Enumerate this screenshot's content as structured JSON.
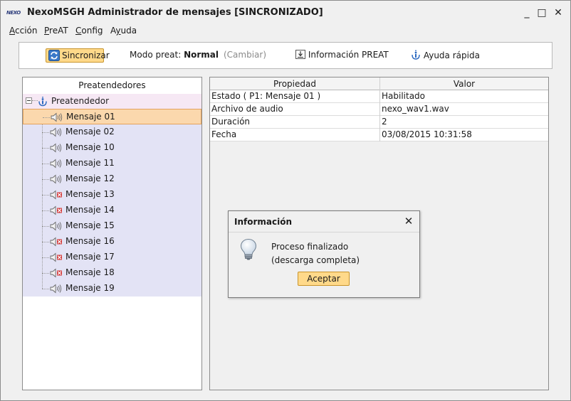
{
  "window": {
    "logo_text": "NEXO",
    "title": "NexoMSGH Administrador de mensajes [SINCRONIZADO]",
    "minimize": "_",
    "maximize": "□",
    "close": "✕"
  },
  "menu": [
    {
      "underline": "A",
      "rest": "cción"
    },
    {
      "underline": "P",
      "rest": "reAT"
    },
    {
      "underline": "C",
      "rest": "onfig"
    },
    {
      "pre": "A",
      "underline": "y",
      "rest": "uda"
    }
  ],
  "toolbar": {
    "sync_label": "Sincronizar",
    "mode_prefix": "Modo preat:",
    "mode_value": "Normal",
    "change_label": "(Cambiar)",
    "info_label": "Información PREAT",
    "help_label": "Ayuda rápida"
  },
  "tree": {
    "header": "Preatendedores",
    "root_label": "Preatendedor",
    "items": [
      {
        "label": "Mensaje 01",
        "status": "enabled",
        "selected": true
      },
      {
        "label": "Mensaje 02",
        "status": "enabled"
      },
      {
        "label": "Mensaje 10",
        "status": "enabled"
      },
      {
        "label": "Mensaje 11",
        "status": "enabled"
      },
      {
        "label": "Mensaje 12",
        "status": "enabled"
      },
      {
        "label": "Mensaje 13",
        "status": "disabled"
      },
      {
        "label": "Mensaje 14",
        "status": "disabled"
      },
      {
        "label": "Mensaje 15",
        "status": "enabled"
      },
      {
        "label": "Mensaje 16",
        "status": "disabled"
      },
      {
        "label": "Mensaje 17",
        "status": "disabled"
      },
      {
        "label": "Mensaje 18",
        "status": "disabled"
      },
      {
        "label": "Mensaje 19",
        "status": "enabled"
      }
    ]
  },
  "properties": {
    "headers": [
      "Propiedad",
      "Valor"
    ],
    "rows": [
      {
        "prop": "Estado ( P1: Mensaje 01 )",
        "value": "Habilitado"
      },
      {
        "prop": "Archivo de audio",
        "value": "nexo_wav1.wav"
      },
      {
        "prop": "Duración",
        "value": "2"
      },
      {
        "prop": "Fecha",
        "value": "03/08/2015 10:31:58"
      }
    ]
  },
  "dialog": {
    "title": "Información",
    "close": "✕",
    "line1": "Proceso finalizado",
    "line2": "(descarga completa)",
    "ok_label": "Aceptar"
  },
  "colors": {
    "accent_button": "#ffd98a",
    "selected_row": "#fbd8ad",
    "tree_background": "#e3e3f5",
    "root_row": "#f6e8f4",
    "disabled_mark": "#d23a3a"
  }
}
